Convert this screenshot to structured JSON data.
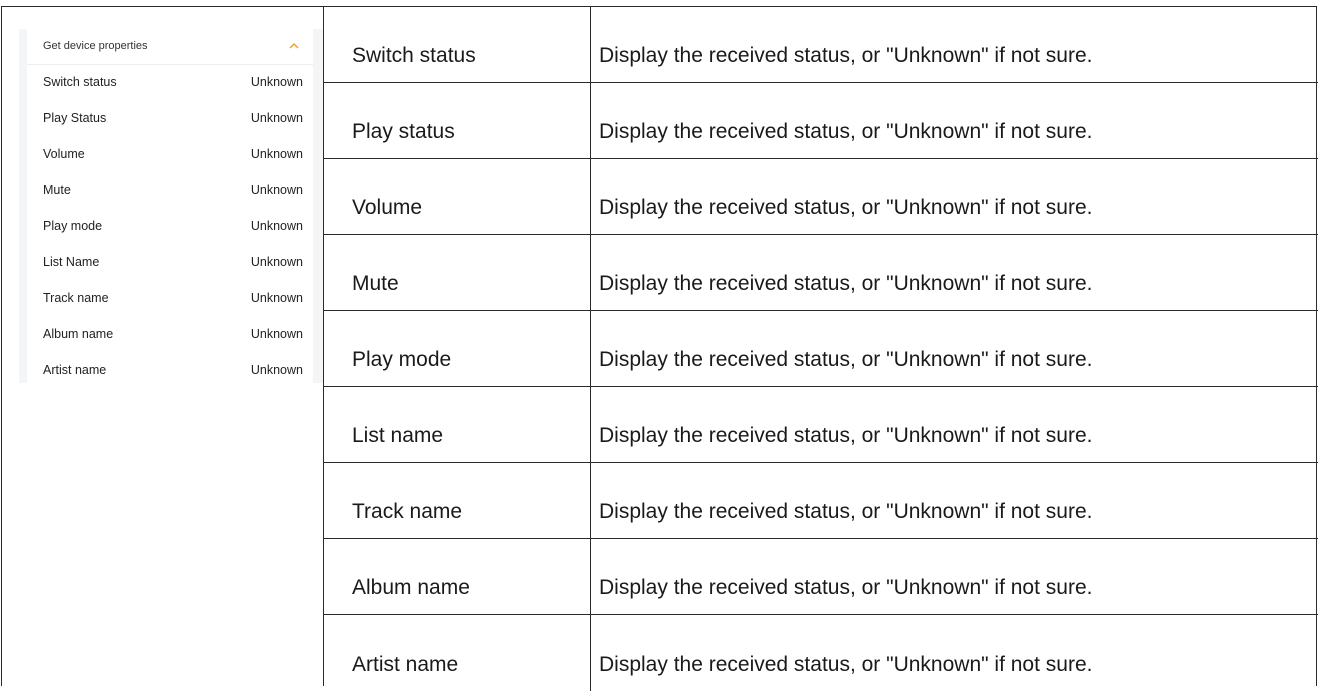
{
  "panel": {
    "title": "Get device properties",
    "properties": [
      {
        "name": "Switch status",
        "value": "Unknown"
      },
      {
        "name": "Play Status",
        "value": "Unknown"
      },
      {
        "name": "Volume",
        "value": "Unknown"
      },
      {
        "name": "Mute",
        "value": "Unknown"
      },
      {
        "name": "Play mode",
        "value": "Unknown"
      },
      {
        "name": "List Name",
        "value": "Unknown"
      },
      {
        "name": "Track name",
        "value": "Unknown"
      },
      {
        "name": "Album name",
        "value": "Unknown"
      },
      {
        "name": "Artist name",
        "value": "Unknown"
      }
    ],
    "chevron_icon": "chevron-up-icon",
    "accent_color": "#f0a020"
  },
  "table": {
    "rows": [
      {
        "field": "Switch status",
        "description": "Display the received status, or \"Unknown\" if not sure."
      },
      {
        "field": "Play status",
        "description": "Display the received status, or \"Unknown\" if not sure."
      },
      {
        "field": "Volume",
        "description": "Display the received status, or \"Unknown\" if not sure."
      },
      {
        "field": "Mute",
        "description": "Display the received status, or \"Unknown\" if not sure."
      },
      {
        "field": "Play mode",
        "description": "Display the received status, or \"Unknown\" if not sure."
      },
      {
        "field": "List name",
        "description": "Display the received status, or \"Unknown\" if not sure."
      },
      {
        "field": "Track name",
        "description": "Display the received status, or \"Unknown\" if not sure."
      },
      {
        "field": "Album name",
        "description": "Display the received status, or \"Unknown\" if not sure."
      },
      {
        "field": "Artist name",
        "description": "Display the received status, or \"Unknown\" if not sure."
      }
    ]
  }
}
